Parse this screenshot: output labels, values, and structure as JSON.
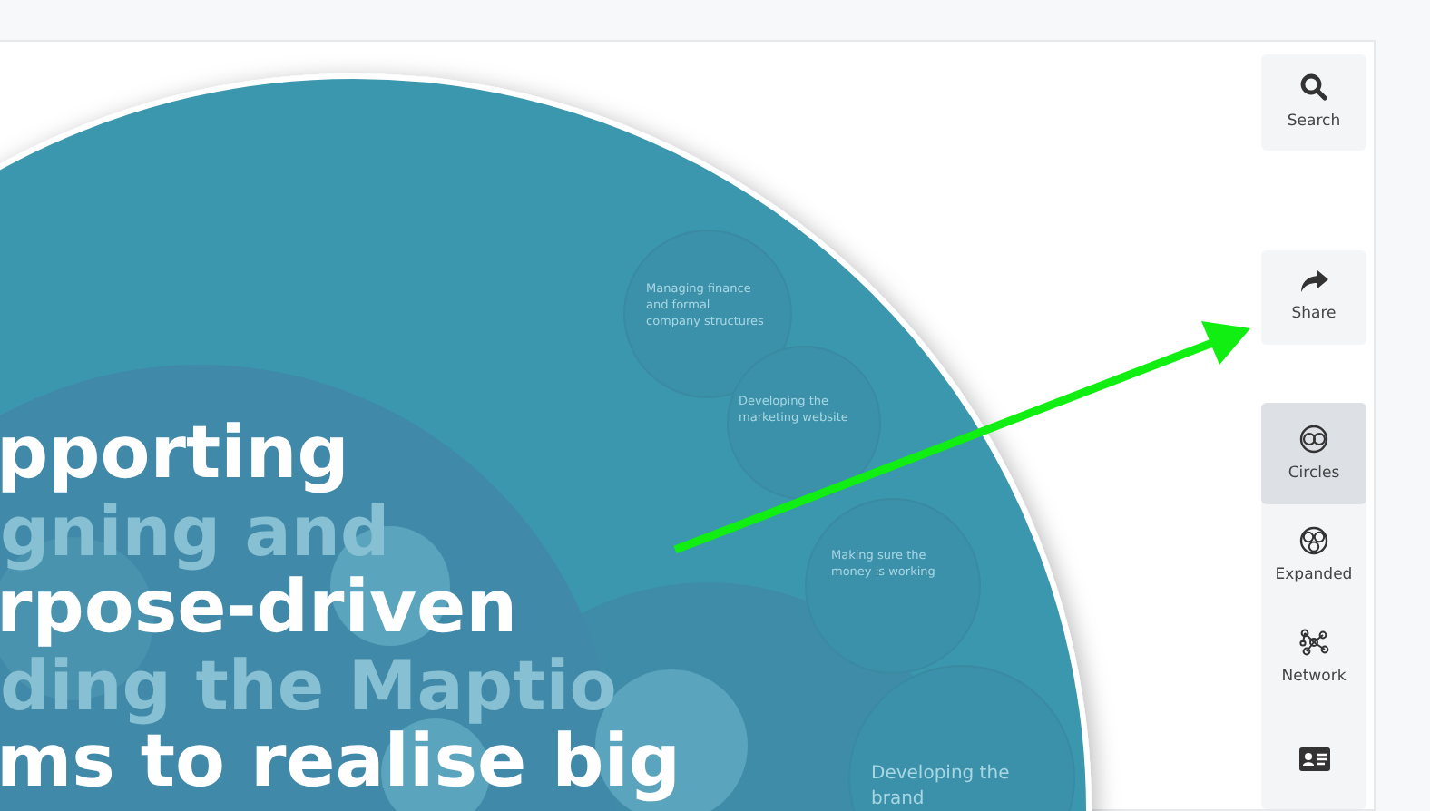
{
  "map": {
    "title_lines": [
      "pporting",
      "rpose-driven",
      "ms to realise big"
    ],
    "background_labels": [
      "gning and",
      "ding the Maptio"
    ],
    "circles": [
      {
        "lines": [
          "Managing finance",
          "and formal",
          "company structures"
        ]
      },
      {
        "lines": [
          "Developing the",
          "marketing website"
        ]
      },
      {
        "lines": [
          "Making sure the",
          "money is working"
        ]
      },
      {
        "lines": [
          "Developing the",
          "brand"
        ]
      }
    ]
  },
  "sidebar": {
    "actions": [
      {
        "kind": "search",
        "label": "Search"
      },
      {
        "kind": "share",
        "label": "Share"
      }
    ],
    "views": [
      {
        "kind": "circles",
        "label": "Circles",
        "selected": true
      },
      {
        "kind": "expanded",
        "label": "Expanded",
        "selected": false
      },
      {
        "kind": "network",
        "label": "Network",
        "selected": false
      },
      {
        "kind": "directory",
        "selected": false
      }
    ]
  }
}
